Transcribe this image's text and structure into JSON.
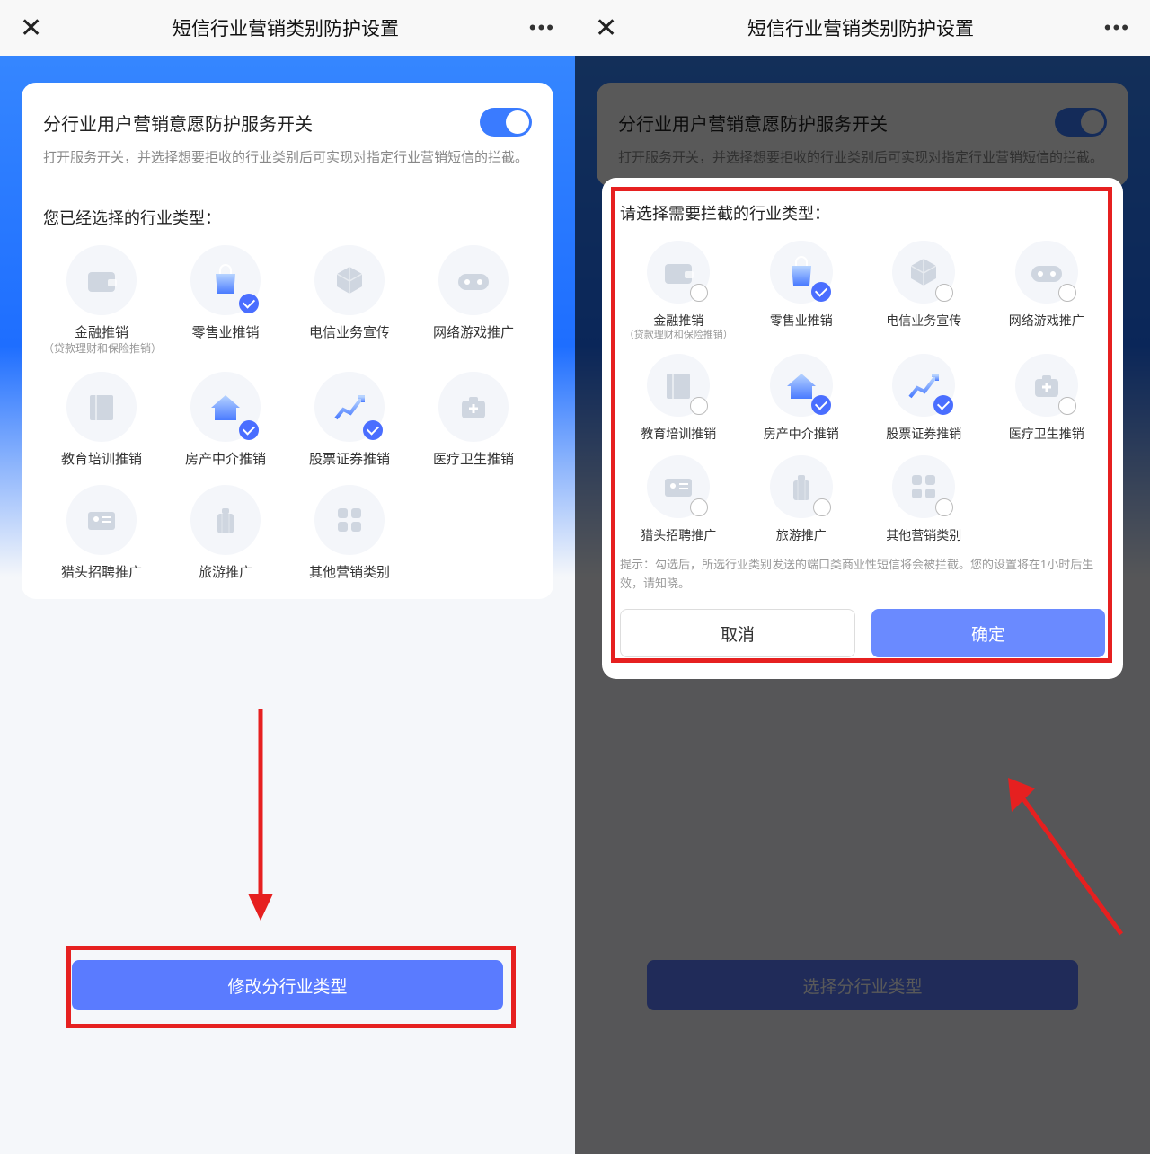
{
  "title": "短信行业营销类别防护设置",
  "toggle_label": "分行业用户营销意愿防护服务开关",
  "toggle_desc": "打开服务开关，并选择想要拒收的行业类别后可实现对指定行业营销短信的拦截。",
  "left": {
    "selected_title": "您已经选择的行业类型：",
    "bottom_button": "修改分行业类型",
    "categories": [
      {
        "name": "金融推销",
        "sub": "（贷款理财和保险推销）",
        "icon": "wallet",
        "checked": false
      },
      {
        "name": "零售业推销",
        "sub": "",
        "icon": "bag",
        "checked": true
      },
      {
        "name": "电信业务宣传",
        "sub": "",
        "icon": "cube",
        "checked": false
      },
      {
        "name": "网络游戏推广",
        "sub": "",
        "icon": "gamepad",
        "checked": false
      },
      {
        "name": "教育培训推销",
        "sub": "",
        "icon": "book",
        "checked": false
      },
      {
        "name": "房产中介推销",
        "sub": "",
        "icon": "house",
        "checked": true
      },
      {
        "name": "股票证券推销",
        "sub": "",
        "icon": "chart",
        "checked": true
      },
      {
        "name": "医疗卫生推销",
        "sub": "",
        "icon": "medkit",
        "checked": false
      },
      {
        "name": "猎头招聘推广",
        "sub": "",
        "icon": "idcard",
        "checked": false
      },
      {
        "name": "旅游推广",
        "sub": "",
        "icon": "luggage",
        "checked": false
      },
      {
        "name": "其他营销类别",
        "sub": "",
        "icon": "apps",
        "checked": false
      }
    ]
  },
  "right": {
    "modal_title": "请选择需要拦截的行业类型：",
    "bottom_button": "选择分行业类型",
    "hint": "提示：勾选后，所选行业类别发送的端口类商业性短信将会被拦截。您的设置将在1小时后生效，请知晓。",
    "cancel": "取消",
    "ok": "确定",
    "categories": [
      {
        "name": "金融推销",
        "sub": "（贷款理财和保险推销）",
        "icon": "wallet",
        "checked": false
      },
      {
        "name": "零售业推销",
        "sub": "",
        "icon": "bag",
        "checked": true
      },
      {
        "name": "电信业务宣传",
        "sub": "",
        "icon": "cube",
        "checked": false
      },
      {
        "name": "网络游戏推广",
        "sub": "",
        "icon": "gamepad",
        "checked": false
      },
      {
        "name": "教育培训推销",
        "sub": "",
        "icon": "book",
        "checked": false
      },
      {
        "name": "房产中介推销",
        "sub": "",
        "icon": "house",
        "checked": true
      },
      {
        "name": "股票证券推销",
        "sub": "",
        "icon": "chart",
        "checked": true
      },
      {
        "name": "医疗卫生推销",
        "sub": "",
        "icon": "medkit",
        "checked": false
      },
      {
        "name": "猎头招聘推广",
        "sub": "",
        "icon": "idcard",
        "checked": false
      },
      {
        "name": "旅游推广",
        "sub": "",
        "icon": "luggage",
        "checked": false
      },
      {
        "name": "其他营销类别",
        "sub": "",
        "icon": "apps",
        "checked": false
      }
    ]
  },
  "colors": {
    "accent": "#4a6eff",
    "danger": "#e62020"
  }
}
